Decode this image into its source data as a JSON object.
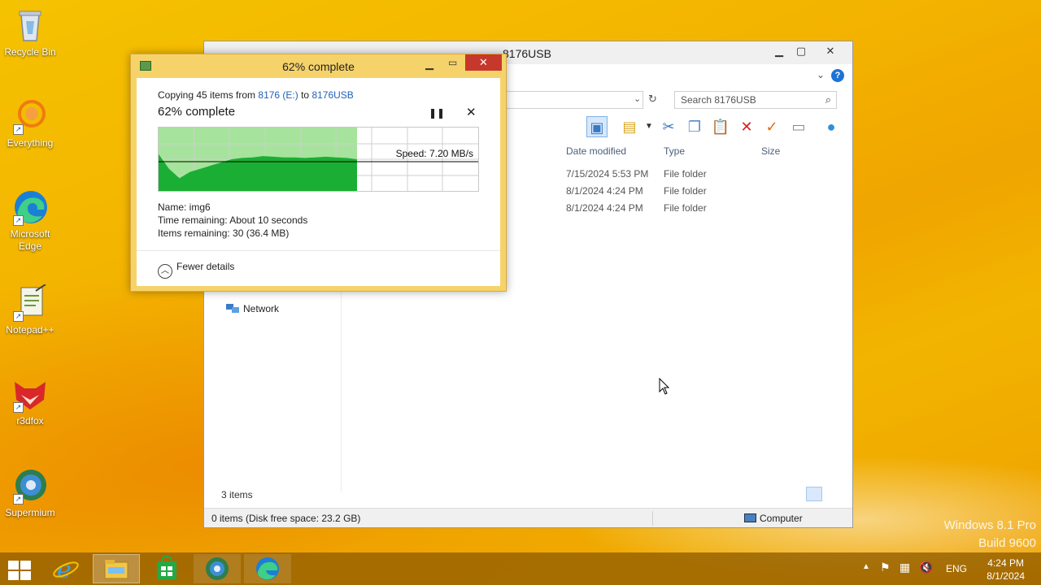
{
  "desktop": {
    "icons": [
      {
        "label": "Recycle Bin",
        "icon": "recycle-bin-icon"
      },
      {
        "label": "Everything",
        "icon": "everything-icon"
      },
      {
        "label": "Microsoft Edge",
        "icon": "edge-icon"
      },
      {
        "label": "Notepad++",
        "icon": "notepadpp-icon"
      },
      {
        "label": "r3dfox",
        "icon": "r3dfox-icon"
      },
      {
        "label": "Supermium",
        "icon": "supermium-icon"
      }
    ],
    "watermark_line1": "Windows 8.1 Pro",
    "watermark_line2": "Build 9600"
  },
  "explorer": {
    "title": "8176USB",
    "search_placeholder": "Search 8176USB",
    "columns": {
      "date": "Date modified",
      "type": "Type",
      "size": "Size"
    },
    "rows": [
      {
        "date": "7/15/2024 5:53 PM",
        "type": "File folder"
      },
      {
        "date": "8/1/2024 4:24 PM",
        "type": "File folder"
      },
      {
        "date": "8/1/2024 4:24 PM",
        "type": "File folder"
      }
    ],
    "nav_network": "Network",
    "items_count": "3 items",
    "status_left": "0 items (Disk free space: 23.2 GB)",
    "status_right": "Computer"
  },
  "copy_dialog": {
    "title": "62% complete",
    "copying_prefix": "Copying 45 items from ",
    "source": "8176 (E:)",
    "copying_mid": " to ",
    "dest": "8176USB",
    "heading": "62% complete",
    "progress": 0.62,
    "speed": "Speed: 7.20 MB/s",
    "name_line": "Name:  img6",
    "time_line": "Time remaining:  About 10 seconds",
    "items_line": "Items remaining:  30 (36.4 MB)",
    "fewer_details": "Fewer details",
    "colors": {
      "fill": "#1aae34",
      "fill_light": "#a6e39c",
      "link": "#1f5fb8"
    }
  },
  "taskbar": {
    "apps": [
      {
        "name": "internet-explorer",
        "icon": "ie-icon"
      },
      {
        "name": "file-explorer",
        "icon": "file-explorer-icon"
      },
      {
        "name": "store",
        "icon": "store-icon"
      },
      {
        "name": "supermium",
        "icon": "supermium-icon"
      },
      {
        "name": "edge",
        "icon": "edge-icon"
      }
    ],
    "lang": "ENG",
    "time": "4:24 PM",
    "date": "8/1/2024"
  }
}
